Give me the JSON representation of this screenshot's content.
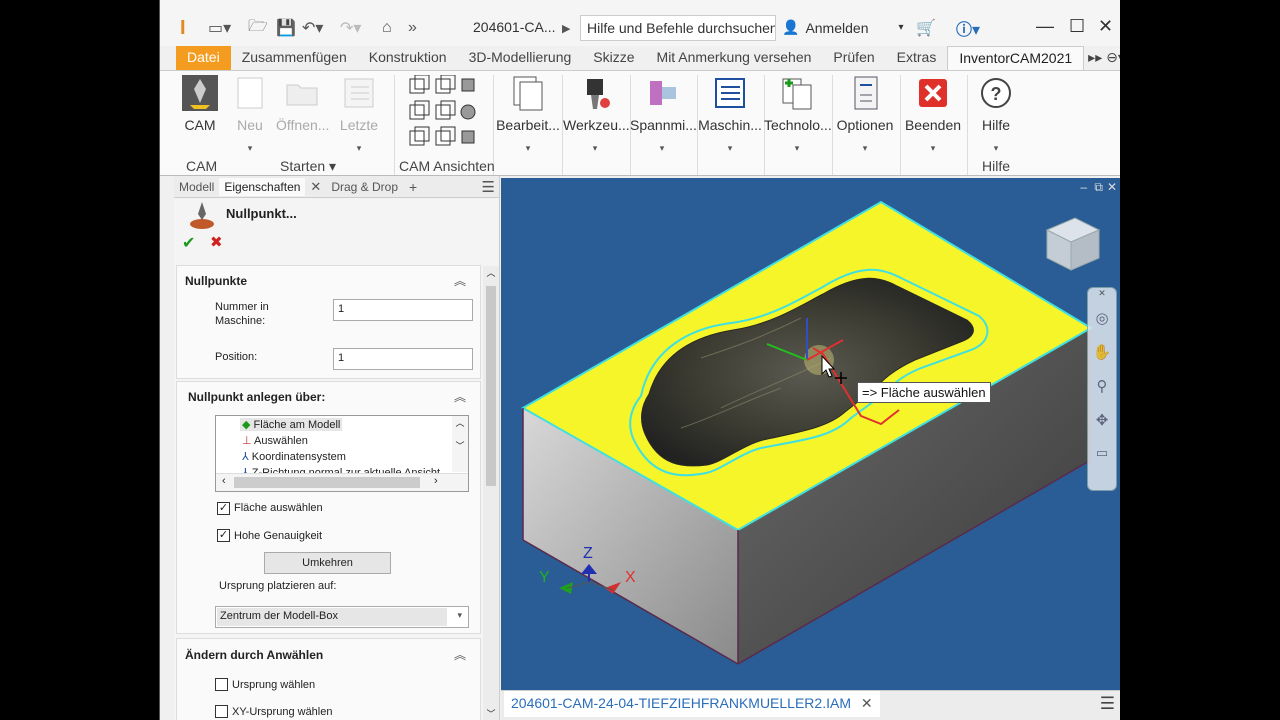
{
  "titlebar": {
    "doc_title": "204601-CA...",
    "search_placeholder": "Hilfe und Befehle durchsuchen...",
    "signin_label": "Anmelden"
  },
  "ribbon_tabs": [
    "Datei",
    "Zusammenfügen",
    "Konstruktion",
    "3D-Modellierung",
    "Skizze",
    "Mit Anmerkung versehen",
    "Prüfen",
    "Extras",
    "InventorCAM2021"
  ],
  "ribbon": {
    "cam": "CAM",
    "neu": "Neu",
    "oeffnen": "Öffnen...",
    "letzte": "Letzte",
    "bearbeiten": "Bearbeit...",
    "werkzeug": "Werkzeu...",
    "spannmittel": "Spannmi...",
    "maschine": "Maschin...",
    "technologie": "Technolo...",
    "optionen": "Optionen",
    "beenden": "Beenden",
    "hilfe": "Hilfe",
    "groups": {
      "cam": "CAM",
      "starten": "Starten",
      "cam_ansichten": "CAM Ansichten",
      "hilfe": "Hilfe"
    }
  },
  "panel": {
    "tabs": [
      "Modell",
      "Eigenschaften",
      "Drag & Drop"
    ],
    "header_title": "Nullpunkt...",
    "nullpunkte": {
      "title": "Nullpunkte",
      "nummer_label": "Nummer in Maschine:",
      "nummer_value": "1",
      "position_label": "Position:",
      "position_value": "1"
    },
    "anlegen": {
      "title": "Nullpunkt anlegen über:",
      "items": [
        "Fläche am Modell",
        "Auswählen",
        "Koordinatensystem",
        "Z-Richtung normal zur aktuelle Ansicht"
      ],
      "flaeche_auswaehlen": "Fläche auswählen",
      "hohe_genauigkeit": "Hohe Genauigkeit",
      "umkehren": "Umkehren",
      "ursprung_label": "Ursprung platzieren auf:",
      "ursprung_value": "Zentrum der Modell-Box"
    },
    "aendern": {
      "title": "Ändern durch Anwählen",
      "ursprung_waehlen": "Ursprung wählen",
      "xy_ursprung": "XY-Ursprung wählen"
    }
  },
  "viewport": {
    "tooltip": "=> Fläche auswählen",
    "axis_x": "X",
    "axis_y": "Y",
    "axis_z": "Z",
    "doc_tab": "204601-CAM-24-04-TIEFZIEHFRANKMUELLER2.IAM"
  },
  "colors": {
    "file_tab": "#f39c1f",
    "viewport_bg": "#2a5d96",
    "top_face": "#f5f52a",
    "edge": "#40e0e0"
  }
}
